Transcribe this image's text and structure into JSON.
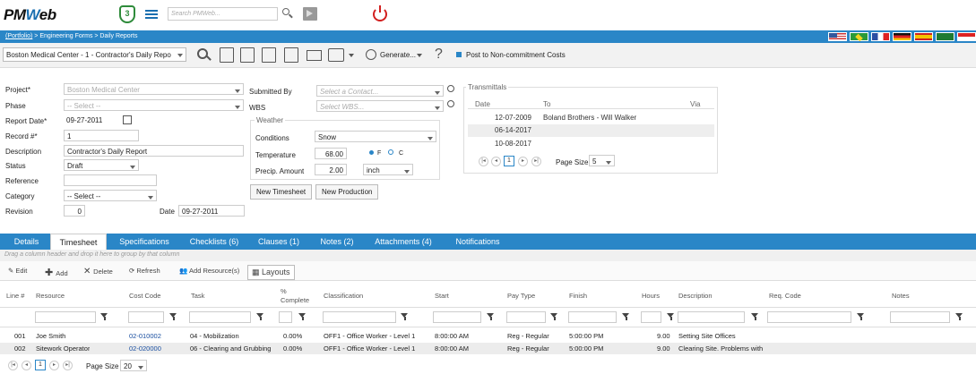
{
  "app": {
    "logo_main": "PM",
    "logo_w": "W",
    "logo_end": "eb",
    "badge": "3",
    "search_placeholder": "Search PMWeb..."
  },
  "breadcrumb": {
    "root": "(Portfolio)",
    "rest": " > Engineering Forms > Daily Reports"
  },
  "toolbar": {
    "record": "Boston Medical Center - 1 - Contractor's Daily Repo",
    "generate": "Generate...",
    "help": "?",
    "post_label": "Post to Non-commitment Costs"
  },
  "form": {
    "project_label": "Project*",
    "project_value": "Boston Medical Center",
    "phase_label": "Phase",
    "phase_value": "-- Select --",
    "report_date_label": "Report Date*",
    "report_date_value": "09-27-2011",
    "record_label": "Record #*",
    "record_value": "1",
    "description_label": "Description",
    "description_value": "Contractor's Daily Report",
    "status_label": "Status",
    "status_value": "Draft",
    "reference_label": "Reference",
    "reference_value": "",
    "category_label": "Category",
    "category_value": "-- Select --",
    "revision_label": "Revision",
    "revision_value": "0",
    "date_label": "Date",
    "date_value": "09-27-2011",
    "submitted_by_label": "Submitted By",
    "submitted_by_placeholder": "Select a Contact...",
    "wbs_label": "WBS",
    "wbs_placeholder": "Select WBS...",
    "weather_legend": "Weather",
    "conditions_label": "Conditions",
    "conditions_value": "Snow",
    "temperature_label": "Temperature",
    "temperature_value": "68.00",
    "unit_f": "F",
    "unit_c": "C",
    "precip_label": "Precip. Amount",
    "precip_value": "2.00",
    "precip_unit": "inch",
    "new_timesheet": "New Timesheet",
    "new_production": "New Production"
  },
  "transmittals": {
    "legend": "Transmittals",
    "headers": [
      "Date",
      "To",
      "Via"
    ],
    "rows": [
      {
        "date": "12-07-2009",
        "to": "Boland Brothers - Will Walker",
        "via": ""
      },
      {
        "date": "06-14-2017",
        "to": "",
        "via": ""
      },
      {
        "date": "10-08-2017",
        "to": "",
        "via": ""
      }
    ],
    "page": "1",
    "page_size_label": "Page Size",
    "page_size": "5"
  },
  "tabs": [
    "Details",
    "Timesheet",
    "Specifications",
    "Checklists (6)",
    "Clauses (1)",
    "Notes (2)",
    "Attachments (4)",
    "Notifications"
  ],
  "grid": {
    "group_hint": "Drag a column header and drop it here to group by that column",
    "tools": {
      "edit": "Edit",
      "add": "Add",
      "delete": "Delete",
      "refresh": "Refresh",
      "add_resources": "Add Resource(s)",
      "layouts": "Layouts"
    },
    "headers": [
      "Line #",
      "Resource",
      "Cost Code",
      "Task",
      "%\nComplete",
      "Classification",
      "Start",
      "Pay Type",
      "Finish",
      "Hours",
      "Description",
      "Req. Code",
      "Notes"
    ],
    "rows": [
      {
        "line": "001",
        "resource": "Joe Smith",
        "cost_code": "02-010002",
        "task": "04 - Mobilization",
        "pct": "0.00%",
        "class": "OFF1 - Office Worker - Level 1",
        "start": "8:00:00 AM",
        "pay": "Reg - Regular",
        "finish": "5:00:00 PM",
        "hours": "9.00",
        "desc": "Setting Site Offices",
        "req": "",
        "notes": ""
      },
      {
        "line": "002",
        "resource": "Sitework Operator",
        "cost_code": "02-020000",
        "task": "06 - Clearing and Grubbing",
        "pct": "0.00%",
        "class": "OFF1 - Office Worker - Level 1",
        "start": "8:00:00 AM",
        "pay": "Reg - Regular",
        "finish": "5:00:00 PM",
        "hours": "9.00",
        "desc": "Clearing Site. Problems with",
        "req": "",
        "notes": ""
      }
    ],
    "page": "1",
    "page_size_label": "Page Size",
    "page_size": "20"
  },
  "colors": {
    "accent": "#2a86c7",
    "brand_blue": "#1a6fb0",
    "power_red": "#d21f1f",
    "badge_green": "#2e8b3a"
  }
}
